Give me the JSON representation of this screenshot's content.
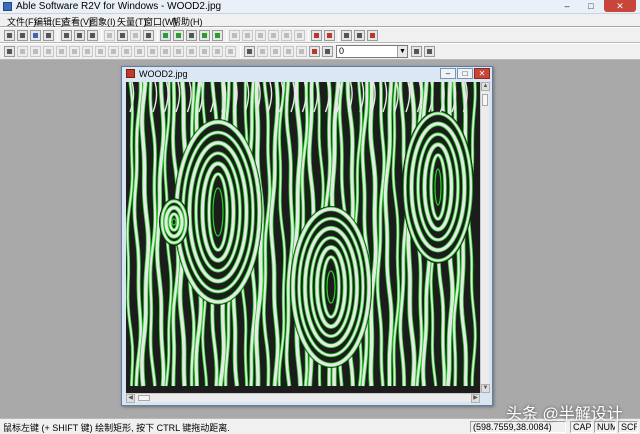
{
  "app": {
    "title": "Able Software R2V for Windows - WOOD2.jpg",
    "window_buttons": {
      "minimize": "–",
      "maximize": "□",
      "close": "✕"
    }
  },
  "menu": {
    "items": [
      {
        "label": "文件(F)"
      },
      {
        "label": "编辑(E)"
      },
      {
        "label": "查看(V)"
      },
      {
        "label": "图象(I)"
      },
      {
        "label": "矢量(T)"
      },
      {
        "label": "窗口(W)"
      },
      {
        "label": "帮助(H)"
      }
    ]
  },
  "toolbar": {
    "layer_select_value": "0",
    "row1_icons": [
      "new-icon",
      "open-icon",
      "save-icon",
      "print-icon",
      "copy-icon",
      "paste-icon",
      "zoom-in-icon",
      "zoom-out-icon",
      "select-icon",
      "pen-icon",
      "pointer-icon",
      "hand-icon",
      "grid-icon",
      "fit-icon",
      "image-view-icon",
      "trace-icon",
      "node-icon",
      "line-icon",
      "snap-icon",
      "delete-icon",
      "add-node-icon",
      "split-icon",
      "join-icon",
      "curve-icon",
      "edit-line-icon",
      "move-icon",
      "measure-icon",
      "color-icon",
      "arrow-icon",
      "help-icon",
      "info-icon",
      "close-icon"
    ],
    "row2_icons": [
      "tool-a-icon",
      "tool-b-icon",
      "tool-c-icon",
      "tool-d-icon",
      "tool-e-icon",
      "tool-f-icon",
      "tool-g-icon",
      "tool-h-icon",
      "tool-i-icon",
      "tool-j-icon",
      "tool-k-icon",
      "tool-l-icon",
      "tool-m-icon",
      "tool-n-icon",
      "tool-o-icon",
      "tool-p-icon",
      "tool-q-icon",
      "tool-r-icon",
      "tool-s-icon",
      "tool-t-icon",
      "tool-u-icon",
      "tool-v-icon",
      "tool-w-icon",
      "tool-x-icon",
      "tool-y-icon",
      "tool-z-icon",
      "layer-up-icon",
      "layer-down-icon"
    ]
  },
  "document": {
    "title": "WOOD2.jpg",
    "image_colors": {
      "background": "#1c1c1c",
      "grain": "#e8e8e8",
      "outline": "#25d425"
    }
  },
  "statusbar": {
    "hint": "鼠标左键 (+ SHIFT 键) 绘制矩形, 按下 CTRL 键拖动距离.",
    "coords": "(598.7559,38.0084)",
    "caps": "CAP",
    "num": "NUM",
    "scrl": "SCRL"
  },
  "watermark": "头条 @半解设计"
}
